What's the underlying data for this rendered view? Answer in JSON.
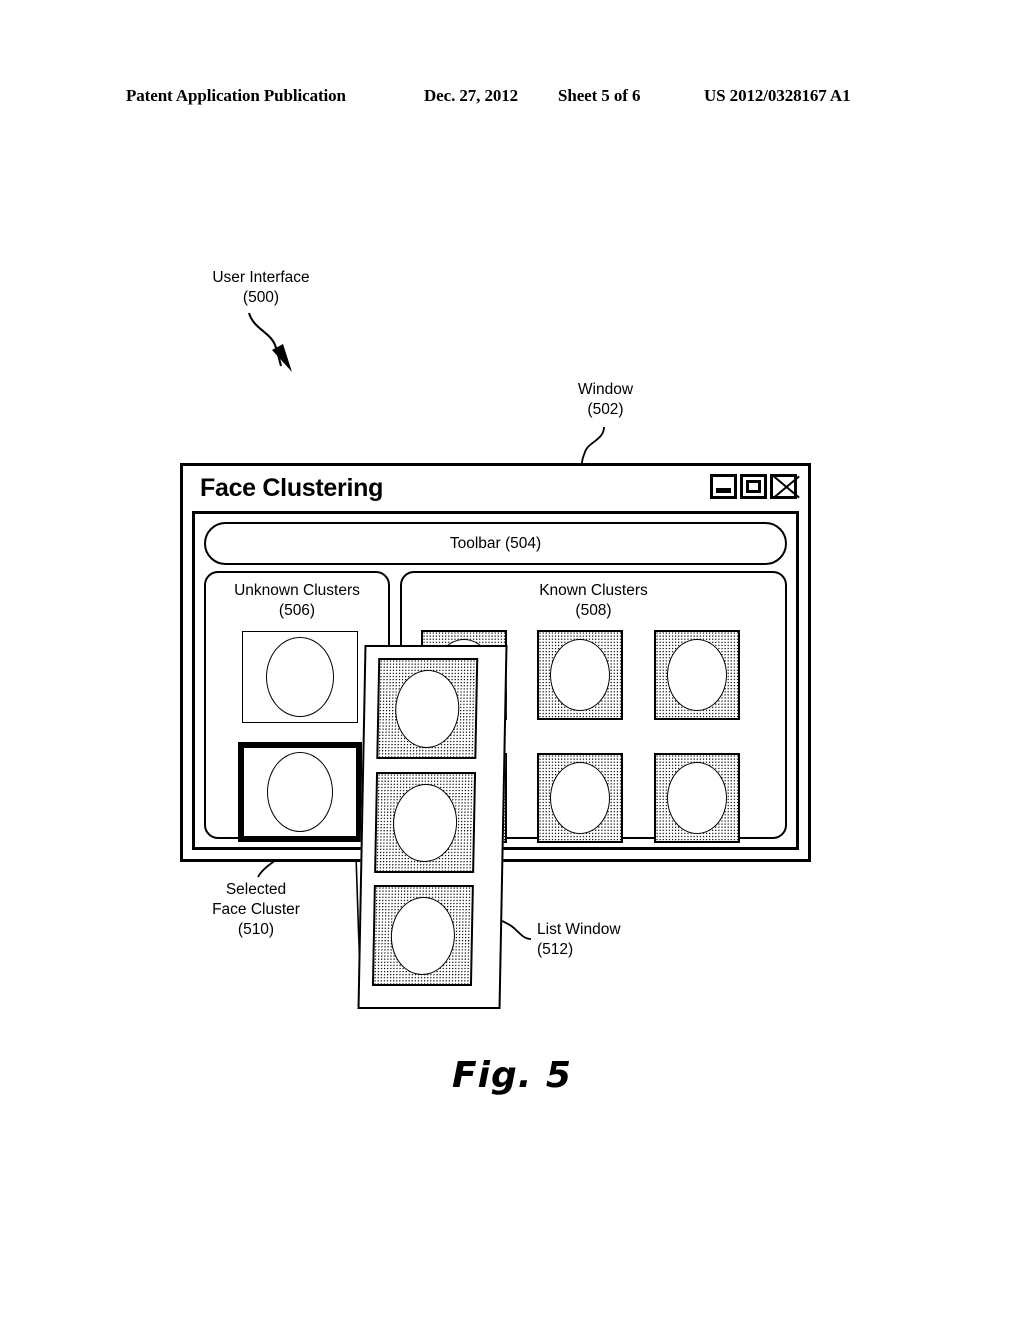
{
  "patent_header": {
    "publication": "Patent Application Publication",
    "date": "Dec. 27, 2012",
    "sheet": "Sheet 5 of 6",
    "number": "US 2012/0328167 A1"
  },
  "callouts": {
    "user_interface": "User Interface\n(500)",
    "window": "Window\n(502)",
    "selected_face_cluster": "Selected\nFace Cluster\n(510)",
    "list_window": "List Window\n(512)"
  },
  "window": {
    "title": "Face Clustering",
    "controls": {
      "minimize": "minimize-icon",
      "maximize": "maximize-icon",
      "close": "close-icon"
    },
    "toolbar": {
      "label": "Toolbar (504)"
    },
    "panels": [
      {
        "id": "unknown",
        "title": "Unknown Clusters\n(506)",
        "thumbnails": [
          {
            "id": "unknown-thumb-1",
            "selected": false,
            "shaded": false
          },
          {
            "id": "unknown-thumb-2",
            "selected": true,
            "shaded": false
          }
        ]
      },
      {
        "id": "known",
        "title": "Known Clusters\n(508)",
        "thumbnails": [
          {
            "id": "known-thumb-r1c1",
            "selected": false,
            "shaded": true
          },
          {
            "id": "known-thumb-r1c2",
            "selected": false,
            "shaded": true
          },
          {
            "id": "known-thumb-r1c3",
            "selected": false,
            "shaded": true
          },
          {
            "id": "known-thumb-r2c1",
            "selected": false,
            "shaded": true
          },
          {
            "id": "known-thumb-r2c2",
            "selected": false,
            "shaded": true
          },
          {
            "id": "known-thumb-r2c3",
            "selected": false,
            "shaded": true
          }
        ]
      }
    ]
  },
  "list_window": {
    "thumbnails": [
      {
        "id": "list-thumb-1",
        "shaded": true
      },
      {
        "id": "list-thumb-2",
        "shaded": true
      },
      {
        "id": "list-thumb-3",
        "shaded": true
      }
    ]
  },
  "figure": {
    "caption": "Fig. 5"
  },
  "colors": {
    "ink": "#000000",
    "paper": "#ffffff"
  }
}
